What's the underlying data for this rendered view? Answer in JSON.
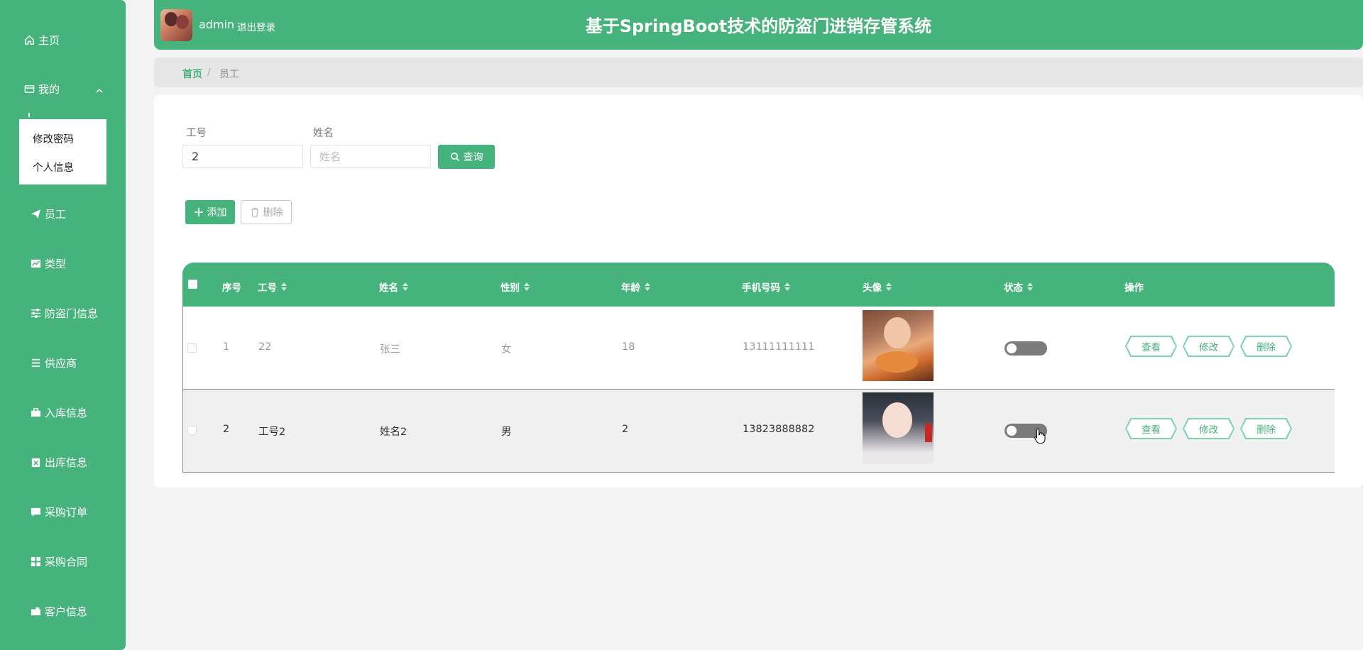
{
  "header": {
    "title": "基于SpringBoot技术的防盗门进销存管系统",
    "username": "admin",
    "logout_label": "退出登录"
  },
  "sidebar": {
    "items": [
      {
        "label": "主页",
        "icon": "home-icon"
      },
      {
        "label": "我的",
        "icon": "wallet-icon"
      },
      {
        "label": "员工",
        "icon": "paper-plane-icon"
      },
      {
        "label": "类型",
        "icon": "chart-icon"
      },
      {
        "label": "防盗门信息",
        "icon": "sliders-icon"
      },
      {
        "label": "供应商",
        "icon": "list-icon"
      },
      {
        "label": "入库信息",
        "icon": "briefcase-icon"
      },
      {
        "label": "出库信息",
        "icon": "clipboard-icon"
      },
      {
        "label": "采购订单",
        "icon": "message-icon"
      },
      {
        "label": "采购合同",
        "icon": "grid-icon"
      },
      {
        "label": "客户信息",
        "icon": "badge-icon"
      }
    ],
    "submenu": [
      "修改密码",
      "个人信息"
    ]
  },
  "breadcrumb": {
    "home": "首页",
    "separator": "/",
    "current": "员工"
  },
  "search": {
    "field1_label": "工号",
    "field1_value": "2",
    "field2_label": "姓名",
    "field2_placeholder": "姓名",
    "query_label": "查询"
  },
  "toolbar": {
    "add_label": "添加",
    "delete_label": "删除"
  },
  "table": {
    "headers": [
      "序号",
      "工号",
      "姓名",
      "性别",
      "年龄",
      "手机号码",
      "头像",
      "状态",
      "操作"
    ],
    "rows": [
      {
        "index": "1",
        "id": "22",
        "name": "张三",
        "gender": "女",
        "age": "18",
        "phone": "13111111111",
        "status": false
      },
      {
        "index": "2",
        "id": "工号2",
        "name": "姓名2",
        "gender": "男",
        "age": "2",
        "phone": "13823888882",
        "status": false
      }
    ],
    "actions": {
      "view": "查看",
      "edit": "修改",
      "delete": "删除"
    }
  },
  "colors": {
    "accent": "#46b27c",
    "action_border": "#7fd2aa"
  }
}
